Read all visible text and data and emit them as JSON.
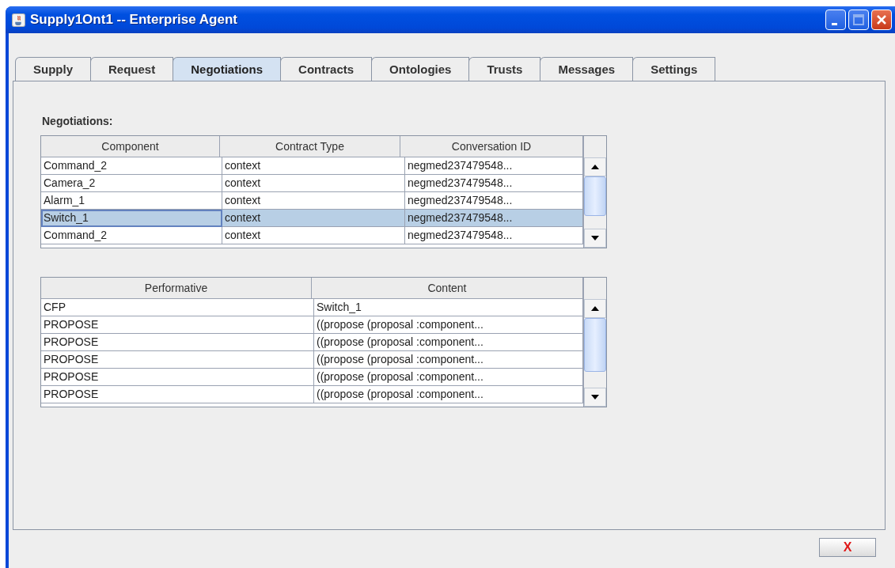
{
  "window": {
    "title": "Supply1Ont1 -- Enterprise Agent"
  },
  "tabs": [
    {
      "label": "Supply",
      "selected": false
    },
    {
      "label": "Request",
      "selected": false
    },
    {
      "label": "Negotiations",
      "selected": true
    },
    {
      "label": "Contracts",
      "selected": false
    },
    {
      "label": "Ontologies",
      "selected": false
    },
    {
      "label": "Trusts",
      "selected": false
    },
    {
      "label": "Messages",
      "selected": false
    },
    {
      "label": "Settings",
      "selected": false
    }
  ],
  "negotiations": {
    "label": "Negotiations:",
    "columns": [
      "Component",
      "Contract Type",
      "Conversation ID"
    ],
    "rows": [
      {
        "cells": [
          "Command_2",
          "context",
          "negmed237479548..."
        ],
        "selected": false
      },
      {
        "cells": [
          "Camera_2",
          "context",
          "negmed237479548..."
        ],
        "selected": false
      },
      {
        "cells": [
          "Alarm_1",
          "context",
          "negmed237479548..."
        ],
        "selected": false
      },
      {
        "cells": [
          "Switch_1",
          "context",
          "negmed237479548..."
        ],
        "selected": true
      },
      {
        "cells": [
          "Command_2",
          "context",
          "negmed237479548..."
        ],
        "selected": false
      }
    ]
  },
  "messages": {
    "columns": [
      "Performative",
      "Content"
    ],
    "rows": [
      {
        "cells": [
          "CFP",
          "Switch_1"
        ]
      },
      {
        "cells": [
          "PROPOSE",
          "((propose (proposal :component..."
        ]
      },
      {
        "cells": [
          "PROPOSE",
          "((propose (proposal :component..."
        ]
      },
      {
        "cells": [
          "PROPOSE",
          "((propose (proposal :component..."
        ]
      },
      {
        "cells": [
          "PROPOSE",
          "((propose (proposal :component..."
        ]
      },
      {
        "cells": [
          "PROPOSE",
          "((propose (proposal :component..."
        ]
      }
    ]
  },
  "close_button": {
    "label": "X"
  }
}
